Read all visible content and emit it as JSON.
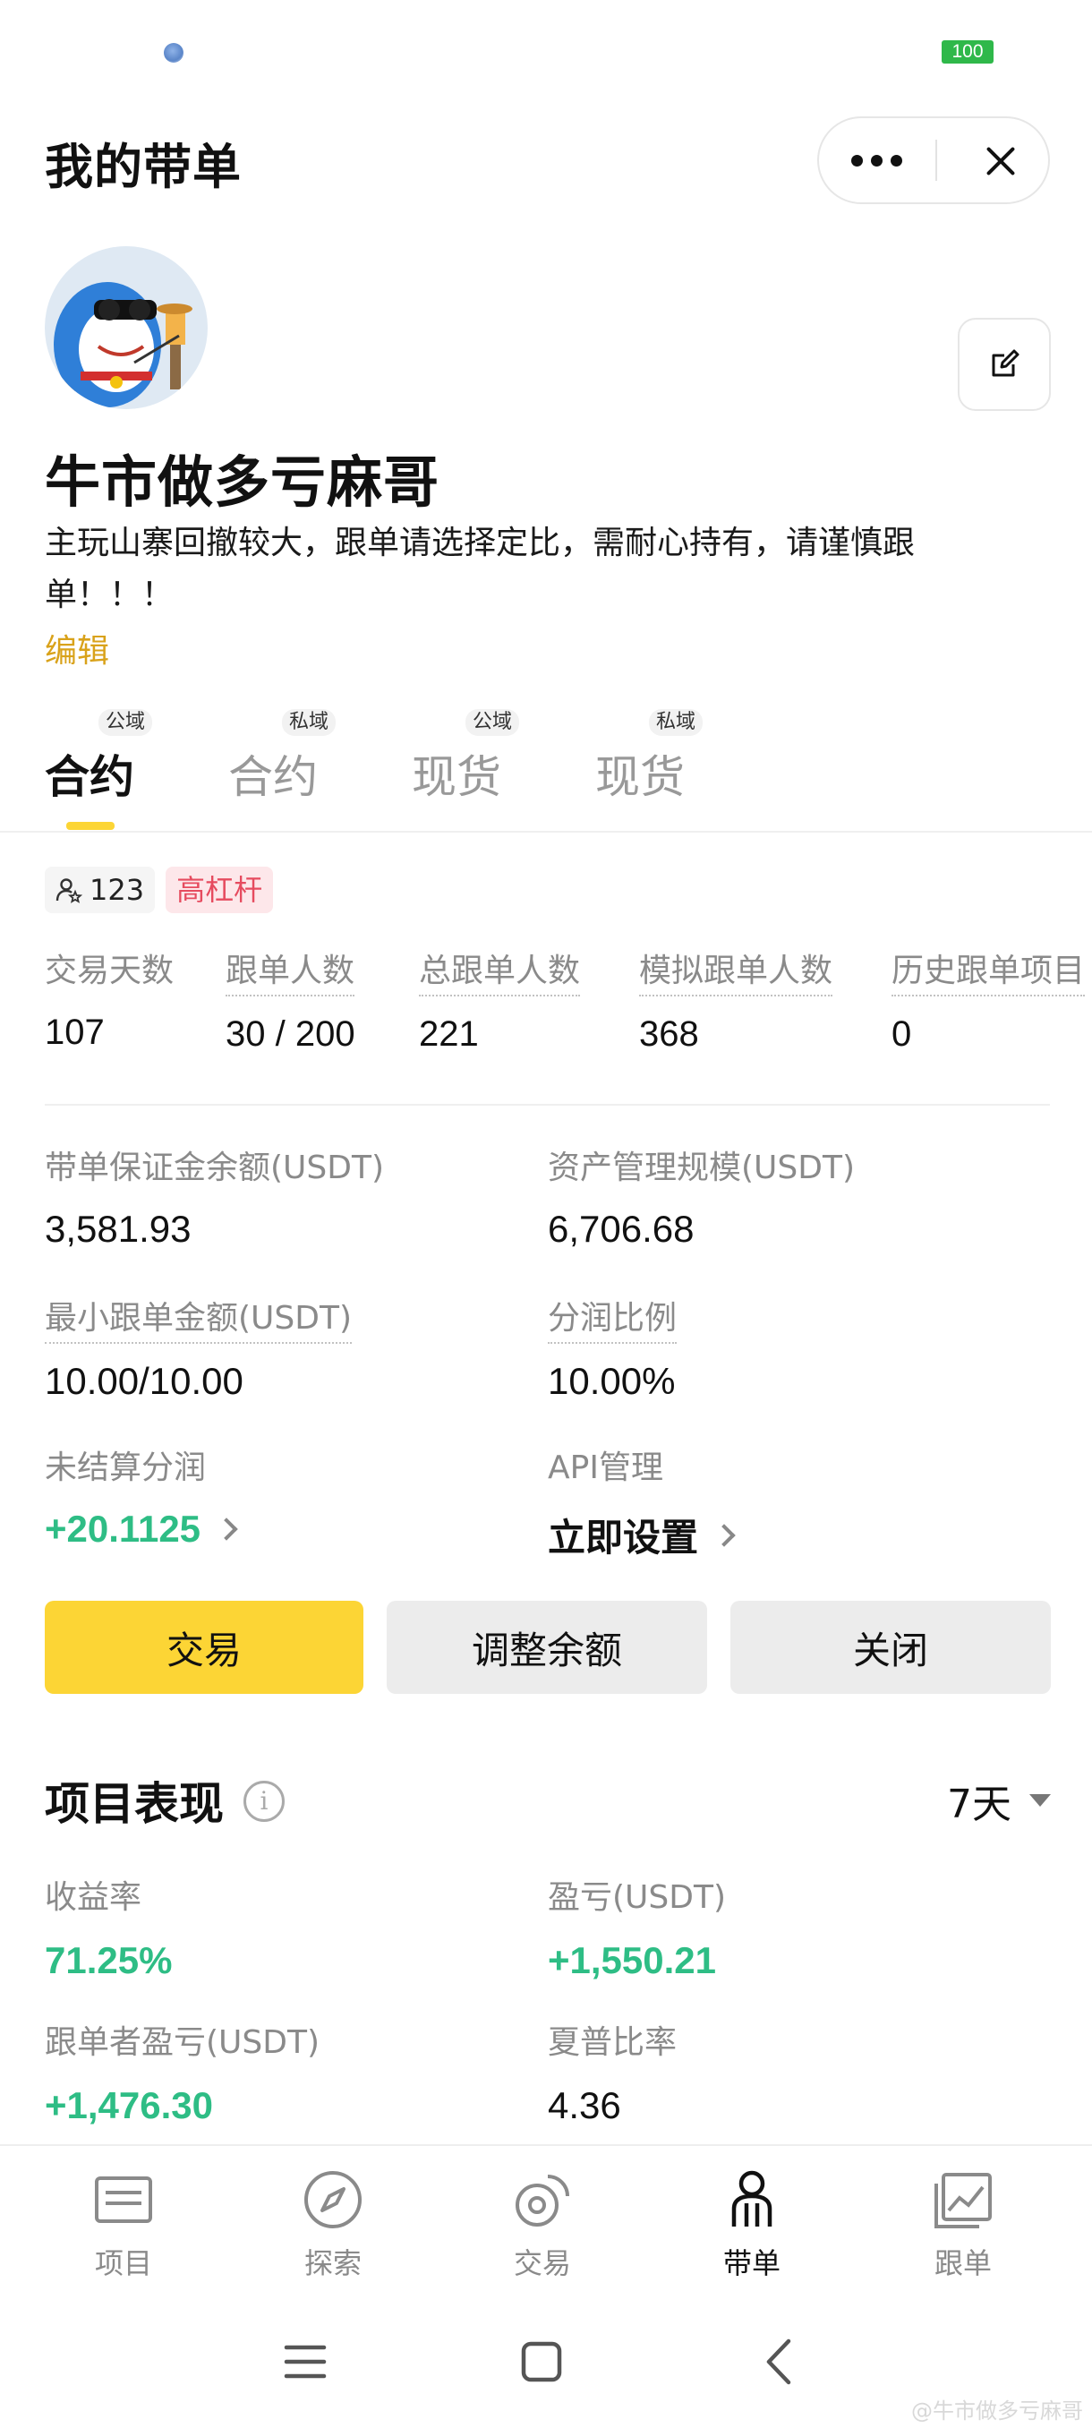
{
  "status_bar": {
    "battery": "100"
  },
  "header": {
    "title": "我的带单"
  },
  "profile": {
    "nickname": "牛市做多亏麻哥",
    "bio": "主玩山寨回撤较大，跟单请选择定比，需耐心持有，请谨慎跟单！！！",
    "edit_link": "编辑"
  },
  "tabs": [
    {
      "tag": "公域",
      "label": "合约"
    },
    {
      "tag": "私域",
      "label": "合约"
    },
    {
      "tag": "公域",
      "label": "现货"
    },
    {
      "tag": "私域",
      "label": "现货"
    }
  ],
  "badges": {
    "followers": "123",
    "leverage": "高杠杆"
  },
  "stats": [
    {
      "label": "交易天数",
      "value": "107"
    },
    {
      "label": "跟单人数",
      "value": "30 / 200"
    },
    {
      "label": "总跟单人数",
      "value": "221"
    },
    {
      "label": "模拟跟单人数",
      "value": "368"
    },
    {
      "label": "历史跟单项目",
      "value": "0"
    }
  ],
  "info": {
    "margin_balance": {
      "label": "带单保证金余额(USDT)",
      "value": "3,581.93"
    },
    "aum": {
      "label": "资产管理规模(USDT)",
      "value": "6,706.68"
    },
    "min_copy": {
      "label": "最小跟单金额(USDT)",
      "value": "10.00/10.00"
    },
    "profit_share": {
      "label": "分润比例",
      "value": "10.00%"
    },
    "unsettled": {
      "label": "未结算分润",
      "value": "+20.1125"
    },
    "api": {
      "label": "API管理",
      "value": "立即设置"
    }
  },
  "actions": {
    "trade": "交易",
    "adjust": "调整余额",
    "close": "关闭"
  },
  "performance": {
    "title": "项目表现",
    "period": "7天",
    "items": [
      {
        "label": "收益率",
        "value": "71.25%"
      },
      {
        "label": "盈亏(USDT)",
        "value": "+1,550.21"
      },
      {
        "label": "跟单者盈亏(USDT)",
        "value": "+1,476.30"
      },
      {
        "label": "夏普比率",
        "value": "4.36"
      }
    ]
  },
  "nav": [
    {
      "label": "项目"
    },
    {
      "label": "探索"
    },
    {
      "label": "交易"
    },
    {
      "label": "带单"
    },
    {
      "label": "跟单"
    }
  ],
  "colors": {
    "accent": "#fcd535",
    "profit": "#2ebd85",
    "leverage": "#e64b5f",
    "link": "#d9a21a"
  },
  "watermark": "@牛市做多亏麻哥"
}
